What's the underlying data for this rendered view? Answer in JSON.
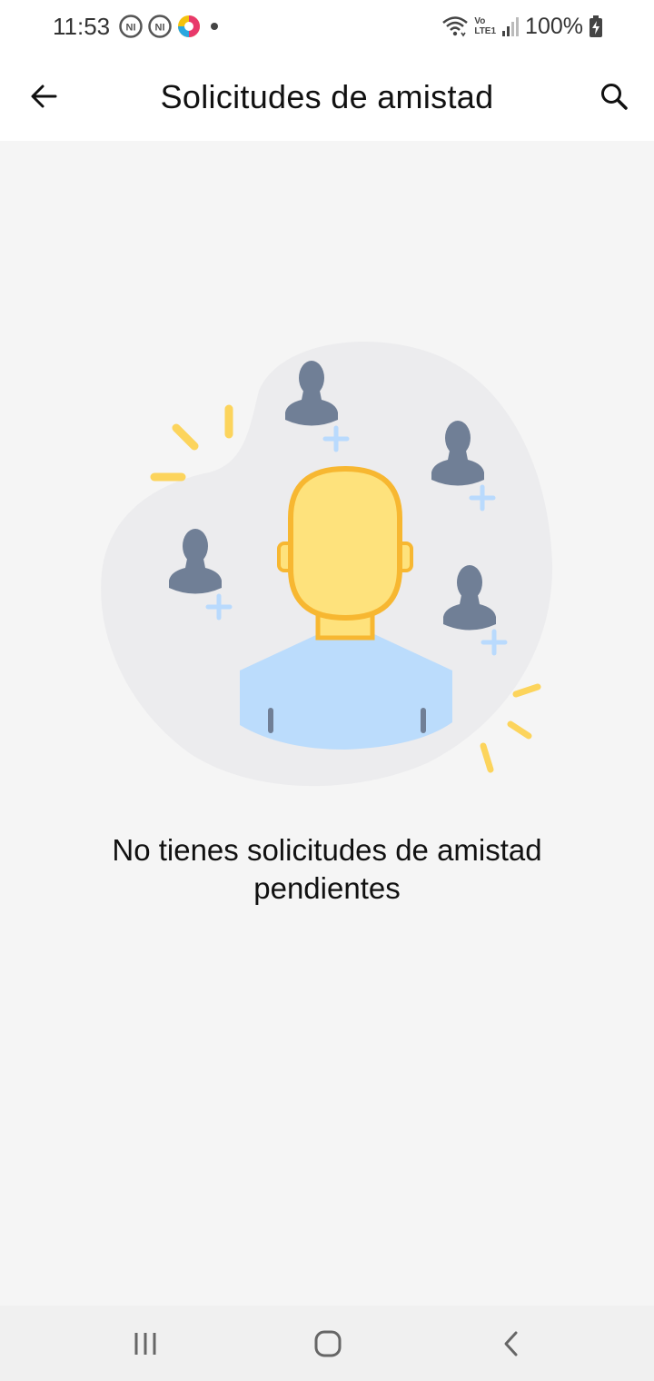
{
  "status_bar": {
    "time": "11:53",
    "battery": "100%",
    "notif_icons": [
      "ni-app-icon",
      "ni-app-icon",
      "colorful-app-icon",
      "dot-icon"
    ],
    "right_icons": [
      "wifi-icon",
      "volte-icon",
      "signal-icon",
      "battery-charging-icon"
    ],
    "volte_label_top": "Vo",
    "volte_label_bottom": "LTE1"
  },
  "app_bar": {
    "title": "Solicitudes de amistad",
    "back_icon": "arrow-left-icon",
    "search_icon": "search-icon"
  },
  "empty_state": {
    "message": "No tienes solicitudes de amistad pendientes",
    "illustration": "friend-requests-illustration",
    "colors": {
      "blob": "#ececee",
      "face": "#fee27c",
      "face_outline": "#f7b731",
      "shirt": "#bbdcfc",
      "avatar": "#707f96",
      "plus": "#b9dafd",
      "spark": "#fcd45c"
    }
  },
  "nav_bar": {
    "recents_icon": "recents-icon",
    "home_icon": "home-icon",
    "back_icon": "chevron-left-icon"
  }
}
